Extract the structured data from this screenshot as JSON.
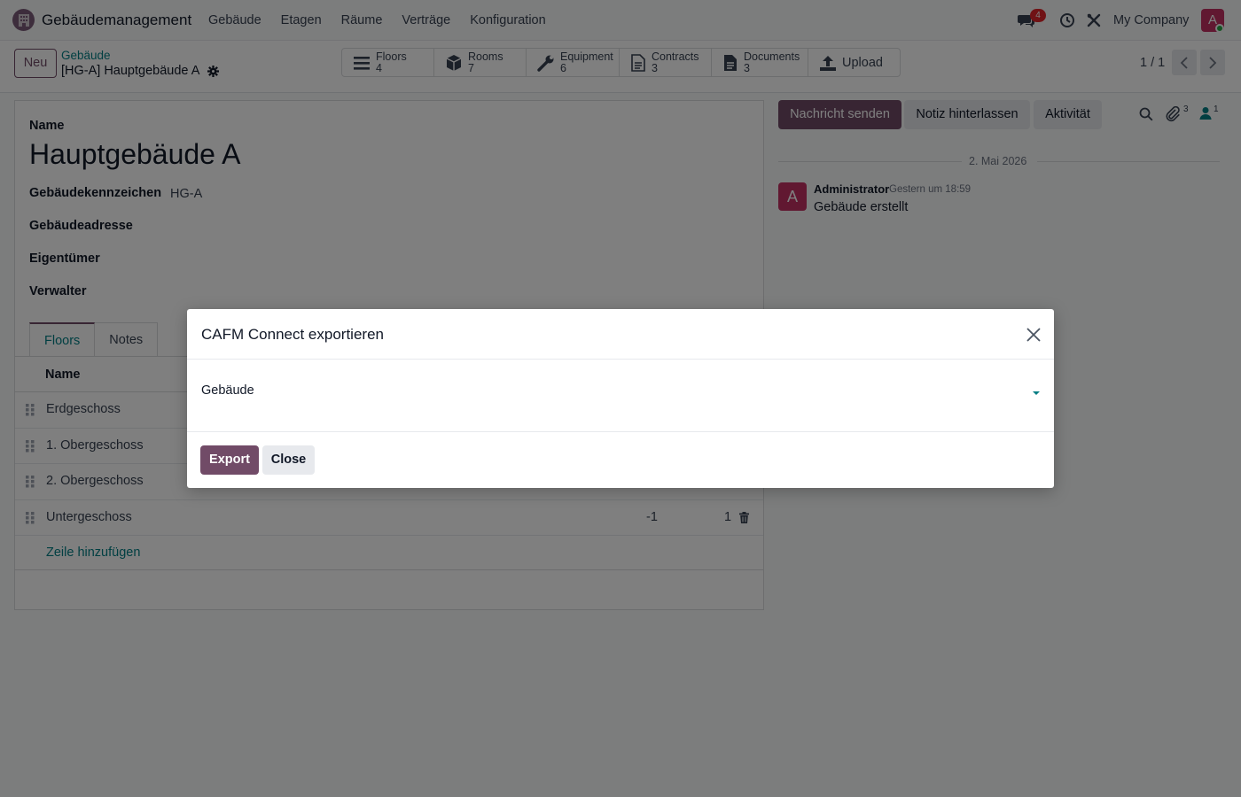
{
  "navbar": {
    "app_name": "Gebäudemanagement",
    "menu": [
      "Gebäude",
      "Etagen",
      "Räume",
      "Verträge",
      "Konfiguration"
    ],
    "chat_badge": "4",
    "company": "My Company",
    "avatar_letter": "A"
  },
  "control_panel": {
    "new_label": "Neu",
    "breadcrumb_parent": "Gebäude",
    "breadcrumb_current": "[HG-A] Hauptgebäude A",
    "smart_buttons": [
      {
        "label": "Floors",
        "count": "4",
        "icon": "list-icon"
      },
      {
        "label": "Rooms",
        "count": "7",
        "icon": "cube-icon"
      },
      {
        "label": "Equipment",
        "count": "6",
        "icon": "wrench-icon"
      },
      {
        "label": "Contracts",
        "count": "3",
        "icon": "document-outline-icon"
      },
      {
        "label": "Documents",
        "count": "3",
        "icon": "document-icon"
      }
    ],
    "upload_label": "Upload",
    "pager": "1 / 1"
  },
  "form": {
    "name_label": "Name",
    "title": "Hauptgebäude A",
    "fields": [
      {
        "label": "Gebäudekennzeichen",
        "value": "HG-A"
      },
      {
        "label": "Gebäudeadresse",
        "value": ""
      },
      {
        "label": "Eigentümer",
        "value": ""
      },
      {
        "label": "Verwalter",
        "value": ""
      }
    ],
    "tabs": [
      "Floors",
      "Notes"
    ],
    "table": {
      "header_name": "Name",
      "rows": [
        {
          "name": "Erdgeschoss",
          "level": "",
          "rooms": ""
        },
        {
          "name": "1. Obergeschoss",
          "level": "",
          "rooms": ""
        },
        {
          "name": "2. Obergeschoss",
          "level": "",
          "rooms": ""
        },
        {
          "name": "Untergeschoss",
          "level": "-1",
          "rooms": "1"
        }
      ],
      "add_line": "Zeile hinzufügen"
    }
  },
  "chatter": {
    "send_message": "Nachricht senden",
    "log_note": "Notiz hinterlassen",
    "activity": "Aktivität",
    "attachments_count": "3",
    "followers_count": "1",
    "date_separator": "2. Mai 2026",
    "message": {
      "avatar_letter": "A",
      "author": "Administrator",
      "time": "Gestern um 18:59",
      "body": "Gebäude erstellt"
    }
  },
  "modal": {
    "title": "CAFM Connect exportieren",
    "field_label": "Gebäude",
    "field_value": "",
    "export_label": "Export",
    "close_label": "Close"
  },
  "colors": {
    "primary": "#714b67",
    "link": "#017e84",
    "badge": "#e0242b",
    "avatar": "#c23162"
  }
}
